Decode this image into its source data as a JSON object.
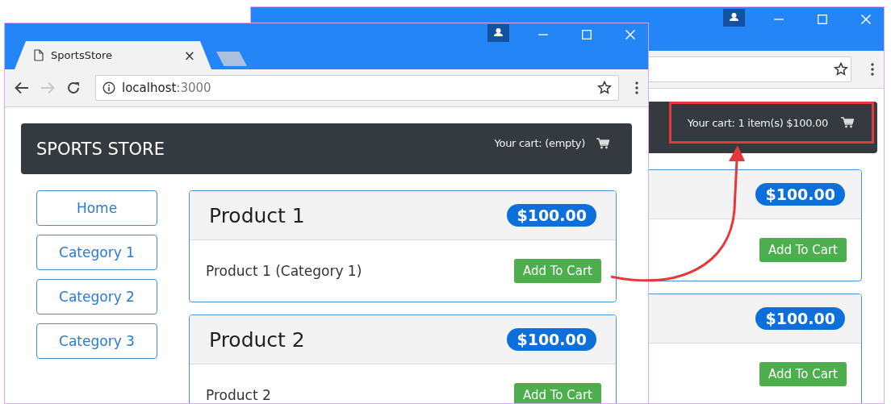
{
  "back_window": {
    "cart_summary": "Your cart: 1 item(s) $100.00",
    "cart_highlighted": true,
    "products": [
      {
        "price": "$100.00",
        "button": "Add To Cart"
      },
      {
        "price": "$100.00",
        "button": "Add To Cart"
      }
    ]
  },
  "front_window": {
    "tab": {
      "title": "SportsStore",
      "close": "×"
    },
    "address": {
      "host": "localhost",
      "port": ":3000"
    },
    "store_name": "SPORTS STORE",
    "cart_summary": "Your cart: (empty)",
    "categories": [
      {
        "label": "Home",
        "selected": false
      },
      {
        "label": "Category 1",
        "selected": false
      },
      {
        "label": "Category 2",
        "selected": false
      },
      {
        "label": "Category 3",
        "selected": false
      }
    ],
    "products": [
      {
        "name": "Product 1",
        "price": "$100.00",
        "description": "Product 1 (Category 1)",
        "button": "Add To Cart"
      },
      {
        "name": "Product 2",
        "price": "$100.00",
        "description": "Product 2",
        "button": "Add To Cart"
      }
    ]
  }
}
